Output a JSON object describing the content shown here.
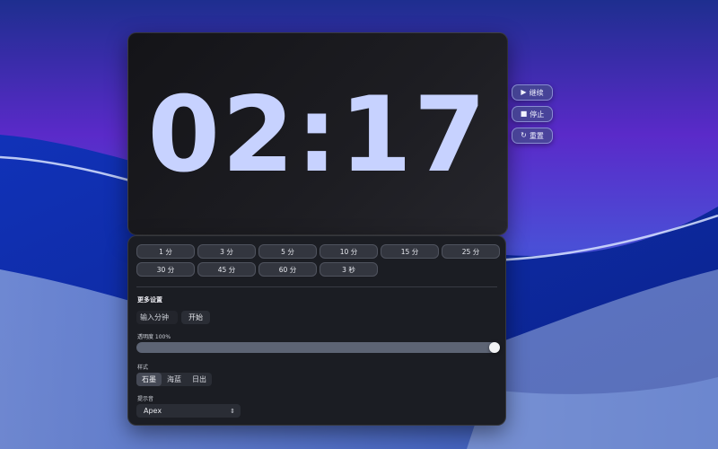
{
  "timer": {
    "display": "02:17"
  },
  "controls": {
    "resume": {
      "label": "继续",
      "icon": "play-icon"
    },
    "stop": {
      "label": "停止",
      "icon": "stop-icon"
    },
    "reset": {
      "label": "重置",
      "icon": "reset-icon"
    }
  },
  "presets": [
    "1 分",
    "3 分",
    "5 分",
    "10 分",
    "15 分",
    "25 分",
    "30 分",
    "45 分",
    "60 分",
    "3 秒"
  ],
  "settings": {
    "title": "更多设置",
    "minutes_placeholder": "输入分钟",
    "start_label": "开始",
    "opacity_label": "透明度 100%",
    "opacity_value": 100,
    "style_label": "样式",
    "styles": [
      "石墨",
      "海蓝",
      "日出"
    ],
    "active_style": "石墨",
    "sound_label": "提示音",
    "sound_value": "Apex"
  },
  "colors": {
    "digits": "#c7d2ff",
    "accent_button": "#464c8c"
  }
}
